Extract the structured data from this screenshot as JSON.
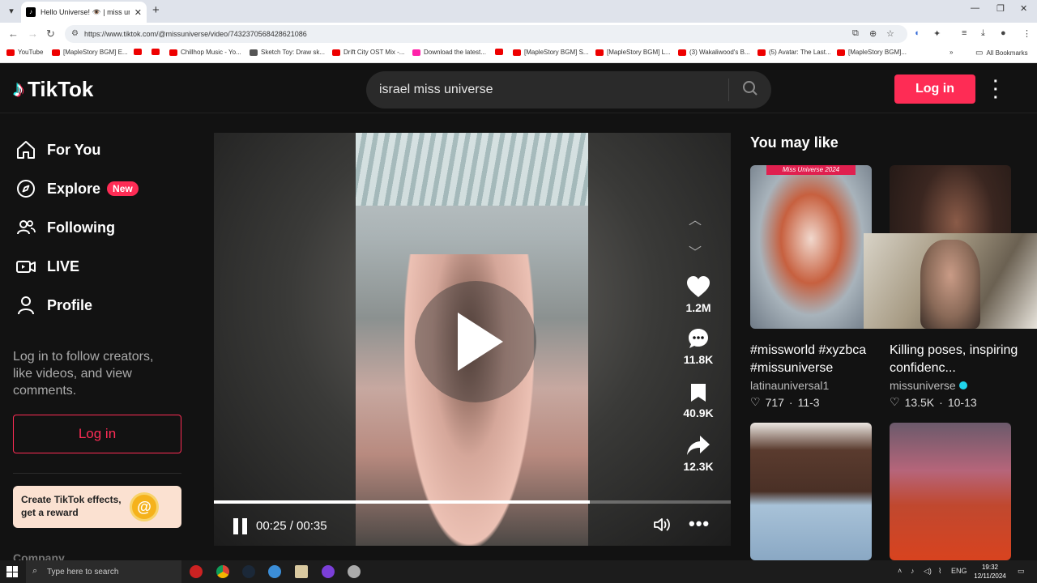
{
  "browser": {
    "tab_title": "Hello Universe! 👁️ | miss unive",
    "url": "https://www.tiktok.com/@missuniverse/video/7432370568428621086",
    "bookmarks": [
      "YouTube",
      "[MapleStory BGM] E...",
      "Chillhop Music - Yo...",
      "Sketch Toy: Draw sk...",
      "Drift City OST Mix -...",
      "Download the latest...",
      "[MapleStory BGM] S...",
      "[MapleStory BGM] L...",
      "(3) Wakaliwood's B...",
      "(5) Avatar: The Last...",
      "[MapleStory BGM]..."
    ],
    "all_bookmarks": "All Bookmarks"
  },
  "header": {
    "logo_text": "TikTok",
    "search_value": "israel miss universe",
    "login_label": "Log in"
  },
  "sidebar": {
    "items": [
      {
        "label": "For You"
      },
      {
        "label": "Explore",
        "badge": "New"
      },
      {
        "label": "Following"
      },
      {
        "label": "LIVE"
      },
      {
        "label": "Profile"
      }
    ],
    "login_message": "Log in to follow creators, like videos, and view comments.",
    "login_label": "Log in",
    "effects_text": "Create TikTok effects, get a reward",
    "company_label": "Company"
  },
  "video": {
    "likes": "1.2M",
    "comments": "11.8K",
    "saves": "40.9K",
    "shares": "12.3K",
    "time": "00:25 / 00:35",
    "progress": 0.727
  },
  "recommendations": {
    "heading": "You may like",
    "cards": [
      {
        "title": "#missworld #xyzbca #missuniverse",
        "author": "latinauniversal1",
        "verified": false,
        "likes": "717",
        "date": "11-3",
        "banner": "Miss Universe 2024"
      },
      {
        "title": "Killing poses, inspiring confidenc...",
        "author": "missuniverse",
        "verified": true,
        "likes": "13.5K",
        "date": "10-13"
      },
      {
        "title": "",
        "author": "",
        "likes": "",
        "date": ""
      },
      {
        "title": "",
        "author": "",
        "likes": "",
        "date": ""
      }
    ]
  },
  "taskbar": {
    "search_placeholder": "Type here to search",
    "lang": "ENG",
    "time": "19:32",
    "date": "12/11/2024"
  },
  "colors": {
    "accent": "#fe2c55",
    "background": "#121212"
  }
}
